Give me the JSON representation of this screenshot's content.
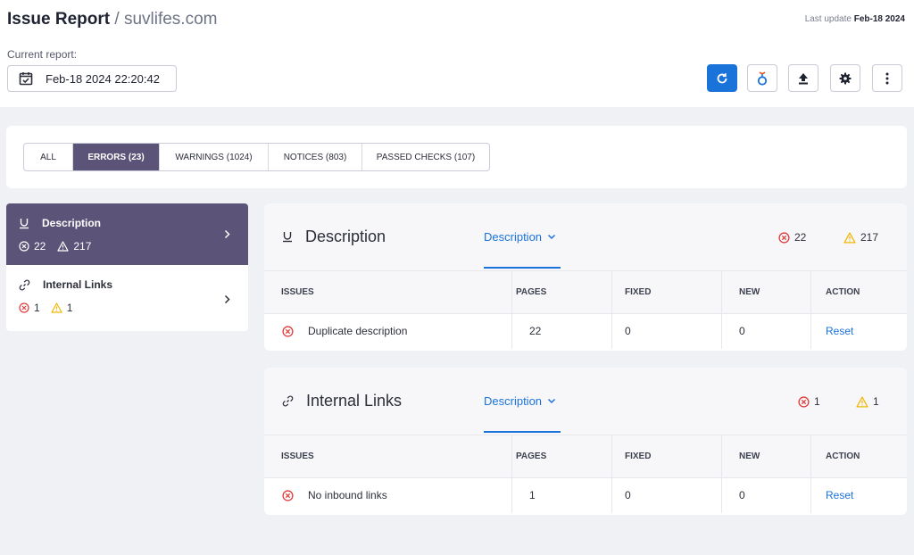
{
  "header": {
    "title": "Issue Report",
    "separator": " / ",
    "site": "suvlifes.com",
    "last_update_label": "Last update",
    "last_update_value": "Feb-18 2024",
    "current_report_label": "Current report:",
    "current_report_value": "Feb-18 2024 22:20:42"
  },
  "toolbar": {
    "buttons": [
      {
        "icon": "refresh-icon"
      },
      {
        "icon": "connect-icon"
      },
      {
        "icon": "upload-icon"
      },
      {
        "icon": "gear-icon"
      },
      {
        "icon": "more-vertical-icon"
      }
    ],
    "primary_color": "#1a73d9"
  },
  "tabs": [
    {
      "label": "ALL",
      "active": false
    },
    {
      "label": "ERRORS (23)",
      "active": true
    },
    {
      "label": "WARNINGS (1024)",
      "active": false
    },
    {
      "label": "NOTICES (803)",
      "active": false
    },
    {
      "label": "PASSED CHECKS (107)",
      "active": false
    }
  ],
  "sidebar": {
    "items": [
      {
        "label": "Description",
        "errors": "22",
        "warnings": "217",
        "icon": "underline-icon",
        "active": true
      },
      {
        "label": "Internal Links",
        "errors": "1",
        "warnings": "1",
        "icon": "link-icon",
        "active": false
      }
    ]
  },
  "panels": [
    {
      "title": "Description",
      "icon": "underline-icon",
      "dropdown": "Description",
      "errors": "22",
      "warnings": "217",
      "columns": [
        "ISSUES",
        "PAGES",
        "FIXED",
        "NEW",
        "ACTION"
      ],
      "rows": [
        {
          "issue": "Duplicate description",
          "pages": "22",
          "fixed": "0",
          "new": "0",
          "action": "Reset"
        }
      ]
    },
    {
      "title": "Internal Links",
      "icon": "link-icon",
      "dropdown": "Description",
      "errors": "1",
      "warnings": "1",
      "columns": [
        "ISSUES",
        "PAGES",
        "FIXED",
        "NEW",
        "ACTION"
      ],
      "rows": [
        {
          "issue": "No inbound links",
          "pages": "1",
          "fixed": "0",
          "new": "0",
          "action": "Reset"
        }
      ]
    }
  ],
  "colors": {
    "accent": "#5b5478",
    "error": "#e03b3b",
    "warning": "#f2b705",
    "link": "#1a73d9"
  }
}
